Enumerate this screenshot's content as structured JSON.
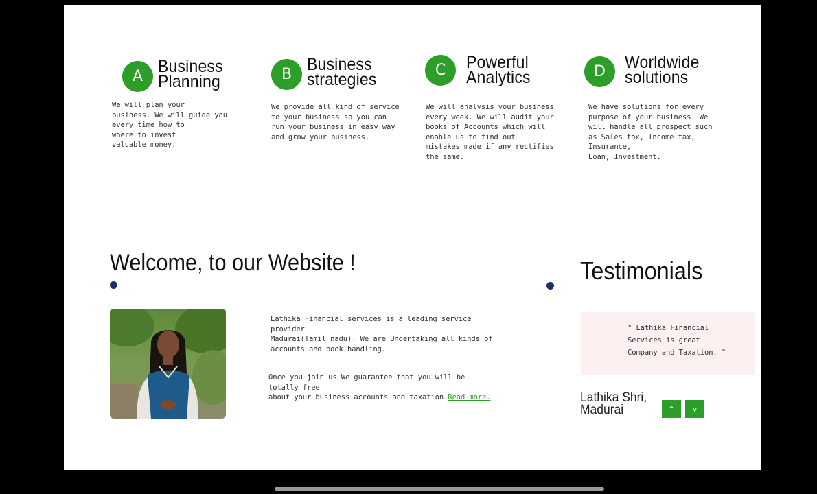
{
  "features": [
    {
      "badge": "A",
      "title_line1": "Business",
      "title_line2": "Planning",
      "description": "We will plan your\nbusiness. We will guide you\nevery time how to\nwhere to invest\nvaluable money."
    },
    {
      "badge": "B",
      "title_line1": "Business",
      "title_line2": "strategies",
      "description": "We provide all kind of service\nto your business so you  can\nrun your business in easy way\nand  grow your business."
    },
    {
      "badge": "C",
      "title_line1": "Powerful",
      "title_line2": "Analytics",
      "description": "We will analysis your business\nevery week. We will audit your\nbooks of Accounts which will\nenable  us to find out\nmistakes made if any rectifies\n the same."
    },
    {
      "badge": "D",
      "title_line1": "Worldwide",
      "title_line2": "solutions",
      "description": "We have solutions for every\npurpose of your business. We\nwill handle all prospect such\nas Sales tax, Income tax, Insurance,\nLoan, Investment."
    }
  ],
  "welcome": {
    "title": "Welcome, to our Website !",
    "paragraph1": "Lathika Financial services is a leading service provider\nMadurai(Tamil nadu). We are Undertaking all  kinds of\naccounts and book handling.",
    "paragraph2": "Once you join us We guarantee that you will be totally free\nabout your business accounts and taxation.",
    "read_more": "Read more."
  },
  "testimonials": {
    "title": "Testimonials",
    "quote": "\" Lathika Financial\nServices is  great\nCompany and Taxation.  \"",
    "author": "Lathika Shri,\nMadurai",
    "up_label": "^",
    "down_label": "v"
  },
  "colors": {
    "accent_green": "#2e9e2a",
    "divider_dot": "#1c2d6b",
    "testimonial_bg": "#fcf0f0"
  }
}
